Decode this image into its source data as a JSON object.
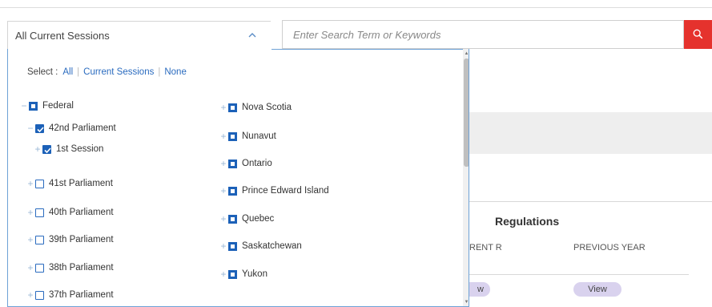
{
  "session_select": {
    "value": "All Current Sessions",
    "icon": "chevron-up-icon"
  },
  "search": {
    "placeholder": "Enter Search Term or Keywords",
    "button_icon": "search-icon",
    "button_color": "#e5322d"
  },
  "dropdown": {
    "select_label": "Select :",
    "select_links": [
      "All",
      "Current Sessions",
      "None"
    ],
    "left_column": [
      {
        "toggle": "−",
        "state": "partial",
        "label": "Federal"
      },
      {
        "toggle": "−",
        "state": "checked",
        "label": "42nd Parliament"
      },
      {
        "toggle": "+",
        "state": "checked",
        "label": "1st Session"
      },
      {
        "toggle": "+",
        "state": "unchecked",
        "label": "41st Parliament"
      },
      {
        "toggle": "+",
        "state": "unchecked",
        "label": "40th Parliament"
      },
      {
        "toggle": "+",
        "state": "unchecked",
        "label": "39th Parliament"
      },
      {
        "toggle": "+",
        "state": "unchecked",
        "label": "38th Parliament"
      },
      {
        "toggle": "+",
        "state": "unchecked",
        "label": "37th Parliament"
      }
    ],
    "right_column": [
      {
        "toggle": "+",
        "state": "partial",
        "label": "Nova Scotia"
      },
      {
        "toggle": "+",
        "state": "partial",
        "label": "Nunavut"
      },
      {
        "toggle": "+",
        "state": "partial",
        "label": "Ontario"
      },
      {
        "toggle": "+",
        "state": "partial",
        "label": "Prince Edward Island"
      },
      {
        "toggle": "+",
        "state": "partial",
        "label": "Quebec"
      },
      {
        "toggle": "+",
        "state": "partial",
        "label": "Saskatchewan"
      },
      {
        "toggle": "+",
        "state": "partial",
        "label": "Yukon"
      }
    ],
    "scroll_up": "▲",
    "scroll_down": "▼"
  },
  "background": {
    "regulations_title": "Regulations",
    "current_year_header": "RENT R",
    "previous_year_header": "PREVIOUS YEAR",
    "view_current": "w",
    "view_previous": "View"
  },
  "colors": {
    "accent": "#1c61b8",
    "link": "#2a6bbf",
    "pill": "#d9d2ee"
  }
}
